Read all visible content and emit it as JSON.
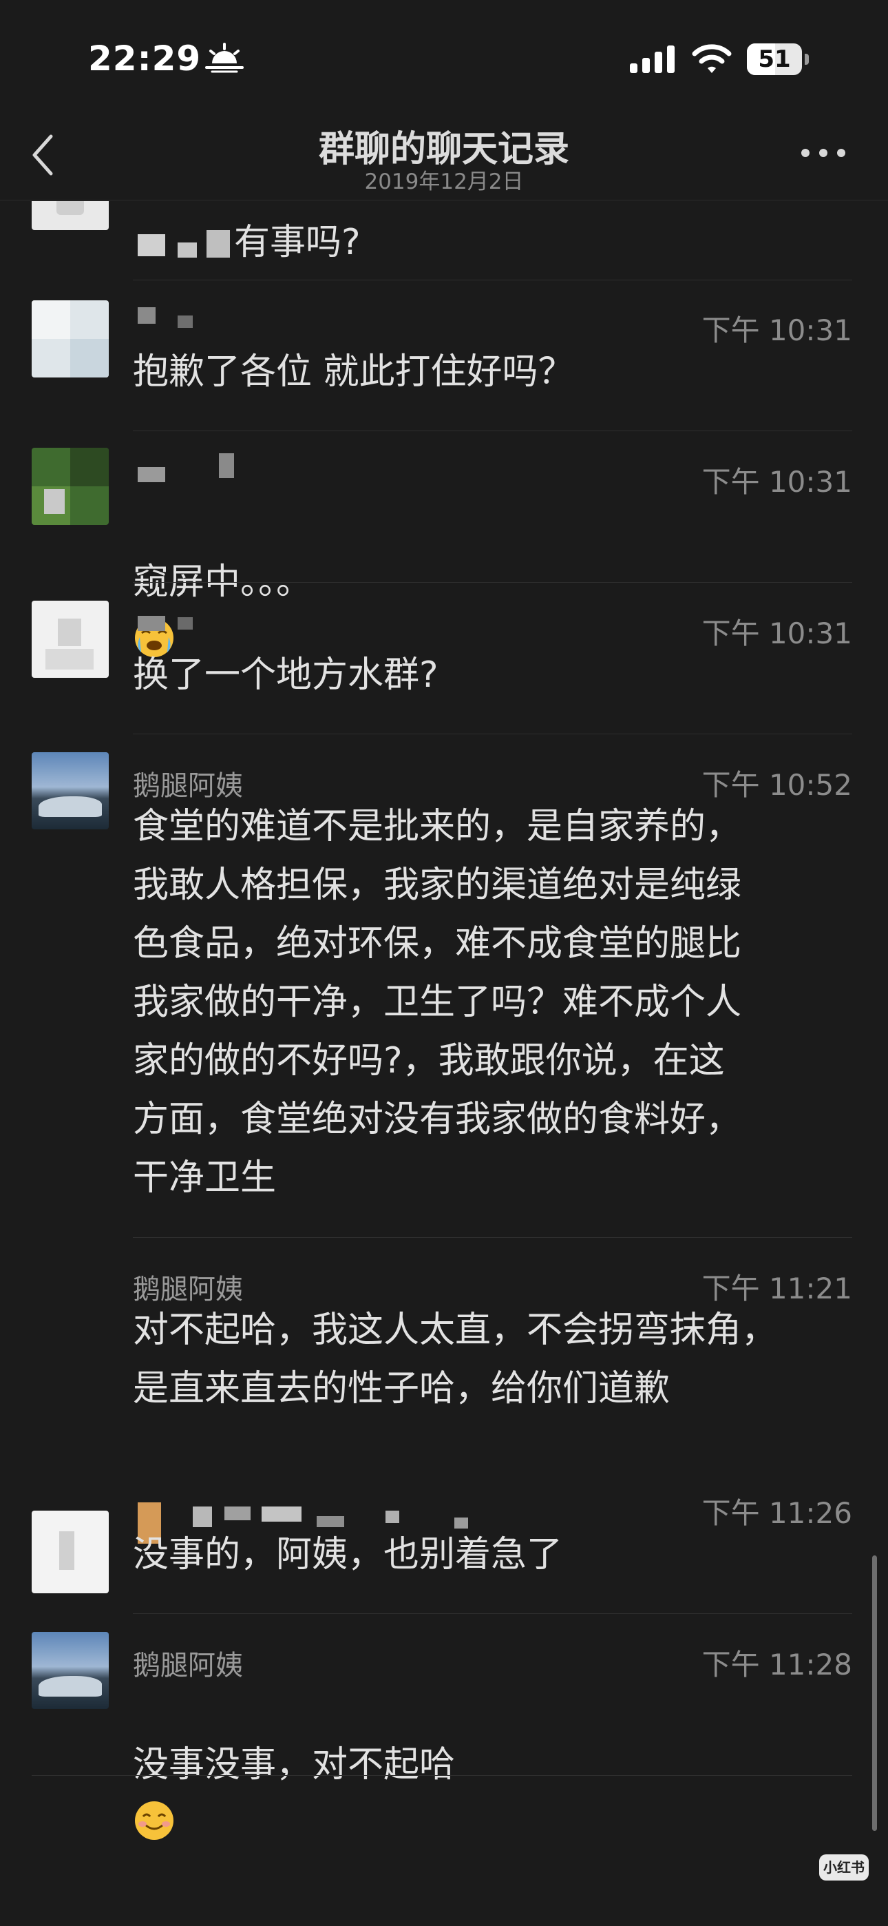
{
  "status_bar": {
    "time": "22:29",
    "battery": "51",
    "battery_level": 0.51
  },
  "nav": {
    "title": "群聊的聊天记录",
    "subtitle": "2019年12月2日"
  },
  "messages": [
    {
      "sender": "",
      "time": "",
      "text": "有事吗?"
    },
    {
      "sender": "",
      "time": "下午 10:31",
      "text": "抱歉了各位 就此打住好吗？"
    },
    {
      "sender": "",
      "time": "下午 10:31",
      "text": "窥屏中。。。"
    },
    {
      "sender": "",
      "time": "下午 10:31",
      "text": "换了一个地方水群?"
    },
    {
      "sender": "鹅腿阿姨",
      "time": "下午 10:52",
      "text": "食堂的难道不是批来的，是自家养的，\n我敢人格担保，我家的渠道绝对是纯绿\n色食品，绝对环保，难不成食堂的腿比\n我家做的干净，卫生了吗？难不成个人\n家的做的不好吗?，我敢跟你说，在这\n方面，食堂绝对没有我家做的食料好，\n干净卫生"
    },
    {
      "sender": "鹅腿阿姨",
      "time": "下午 11:21",
      "text": "对不起哈，我这人太直，不会拐弯抹角，\n是直来直去的性子哈，给你们道歉"
    },
    {
      "sender": "",
      "time": "下午 11:26",
      "text": "没事的，阿姨，也别着急了"
    },
    {
      "sender": "鹅腿阿姨",
      "time": "下午 11:28",
      "text": "没事没事，对不起哈"
    }
  ],
  "watermark": "小红书",
  "icons": {
    "back": "back-icon",
    "more": "more-icon",
    "sun": "sunrise-icon",
    "signal": "signal-icon",
    "wifi": "wifi-icon",
    "weeping_emoji": "weeping-emoji-icon",
    "smile_emoji": "smile-emoji-icon"
  },
  "colors": {
    "background": "#1b1b1b",
    "text": "#e2e2e2",
    "secondary": "#8c8c8c"
  }
}
